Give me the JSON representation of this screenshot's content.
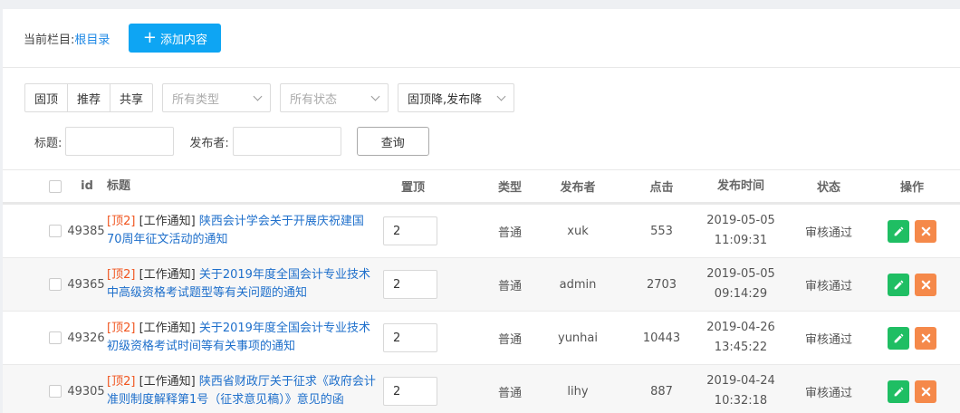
{
  "header": {
    "crumb_label": "当前栏目:",
    "crumb_link": "根目录",
    "add_label": "添加内容",
    "add_icon": "plus-icon"
  },
  "filters": {
    "flags": [
      "固顶",
      "推荐",
      "共享"
    ],
    "type_placeholder": "所有类型",
    "status_placeholder": "所有状态",
    "sort_value": "固顶降,发布降"
  },
  "search": {
    "title_label": "标题:",
    "author_label": "发布者:",
    "query_label": "查询"
  },
  "table": {
    "columns": {
      "id": "id",
      "title": "标题",
      "top": "置顶",
      "type": "类型",
      "author": "发布者",
      "clicks": "点击",
      "time": "发布时间",
      "status": "状态",
      "ops": "操作"
    },
    "rows": [
      {
        "id": "49385",
        "tag": "[顶2]",
        "category": "[工作通知]",
        "title": "陕西会计学会关于开展庆祝建国70周年征文活动的通知",
        "top": "2",
        "type": "普通",
        "author": "xuk",
        "clicks": "553",
        "time": "2019-05-05 11:09:31",
        "status": "审核通过"
      },
      {
        "id": "49365",
        "tag": "[顶2]",
        "category": "[工作通知]",
        "title": "关于2019年度全国会计专业技术中高级资格考试题型等有关问题的通知",
        "top": "2",
        "type": "普通",
        "author": "admin",
        "clicks": "2703",
        "time": "2019-05-05 09:14:29",
        "status": "审核通过"
      },
      {
        "id": "49326",
        "tag": "[顶2]",
        "category": "[工作通知]",
        "title": "关于2019年度全国会计专业技术初级资格考试时间等有关事项的通知",
        "top": "2",
        "type": "普通",
        "author": "yunhai",
        "clicks": "10443",
        "time": "2019-04-26 13:45:22",
        "status": "审核通过"
      },
      {
        "id": "49305",
        "tag": "[顶2]",
        "category": "[工作通知]",
        "title": "陕西省财政厅关于征求《政府会计准则制度解释第1号（征求意见稿）》意见的函",
        "top": "2",
        "type": "普通",
        "author": "lihy",
        "clicks": "887",
        "time": "2019-04-24 10:32:18",
        "status": "审核通过"
      }
    ]
  },
  "colors": {
    "accent": "#0ea5f3",
    "link": "#1e6fcb",
    "top_tag": "#f0551f",
    "edit": "#1fbe63",
    "delete": "#f5894a"
  }
}
